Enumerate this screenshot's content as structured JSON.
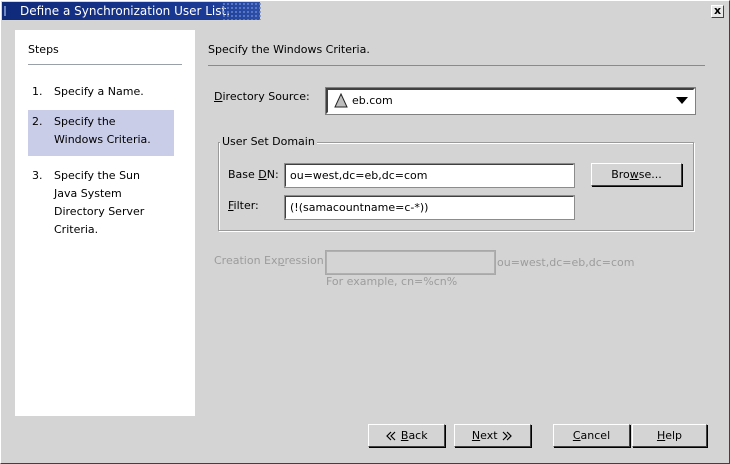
{
  "window": {
    "title": "Define a Synchronization User List.",
    "close_glyph": "x"
  },
  "steps": {
    "heading": "Steps",
    "items": [
      {
        "num": "1.",
        "lines": [
          "Specify a Name."
        ]
      },
      {
        "num": "2.",
        "lines": [
          "Specify the",
          "Windows Criteria."
        ]
      },
      {
        "num": "3.",
        "lines": [
          "Specify the Sun",
          "Java System",
          "Directory Server",
          "Criteria."
        ]
      }
    ]
  },
  "main": {
    "heading": "Specify the Windows Criteria.",
    "directory_source": {
      "label_mnemonic": "D",
      "label_rest": "irectory Source:",
      "value": "eb.com",
      "icon": "triangle-icon",
      "arrow_icon": "chevron-down-icon"
    },
    "user_set_domain": {
      "title": "User Set Domain",
      "base_dn": {
        "label_pre": "Base ",
        "label_mnemonic": "D",
        "label_rest": "N:",
        "value": "ou=west,dc=eb,dc=com"
      },
      "filter": {
        "label_mnemonic": "F",
        "label_rest": "ilter:",
        "value": "(!(samacountname=c-*))"
      },
      "browse": {
        "pre": "Bro",
        "mnemonic": "w",
        "rest": "se..."
      }
    },
    "creation_expression": {
      "label_pre": "Creation Ex",
      "label_mnemonic": "p",
      "label_rest": "ression:",
      "value": "",
      "suffix": "ou=west,dc=eb,dc=com",
      "hint": "For example, cn=%cn%"
    }
  },
  "buttons": {
    "back": {
      "mnemonic": "B",
      "rest": "ack",
      "icon": "chevron-left-icon"
    },
    "next": {
      "mnemonic": "N",
      "rest": "ext",
      "icon": "chevron-right-icon"
    },
    "cancel": {
      "mnemonic": "C",
      "rest": "ancel"
    },
    "help": {
      "mnemonic": "H",
      "rest": "elp"
    }
  }
}
